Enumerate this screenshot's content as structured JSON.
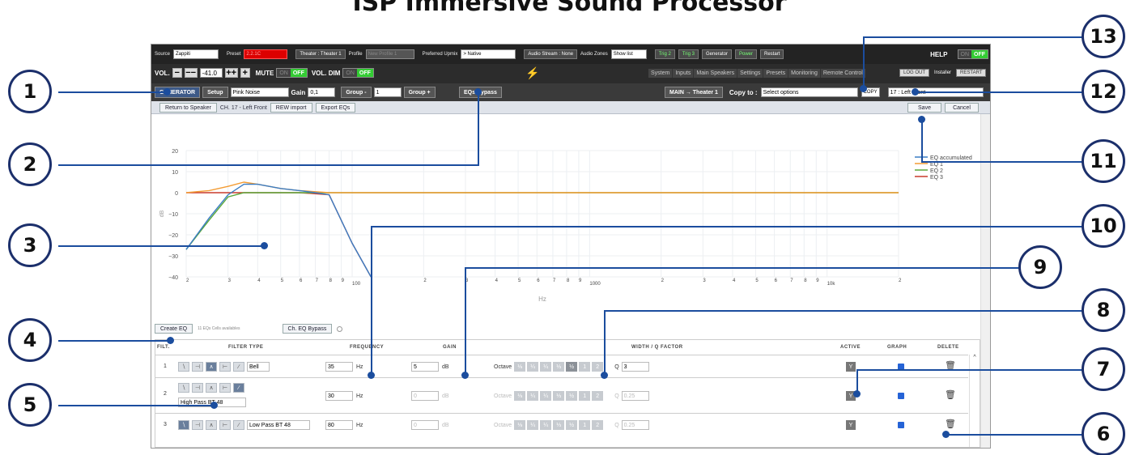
{
  "title": "ISP Immersive Sound Processor",
  "top_bar": {
    "source_label": "Source",
    "source_value": "Zappiti",
    "preset_label": "Preset",
    "preset_value": "2.2.1C",
    "theater_label": "Theater : Theater 1",
    "profile_label": "Profile",
    "profile_value": "New Profile 1",
    "upmix_label": "Preferred Upmix",
    "upmix_value": "> Native",
    "audio_stream": "Audio Stream : None",
    "audio_zones_label": "Audio Zones",
    "audio_zones_value": "Show list",
    "trig2": "Trig 2",
    "trig3": "Trig 3",
    "generator": "Generator",
    "power": "Power",
    "restart": "Restart",
    "help": "HELP",
    "on": "ON",
    "off": "OFF"
  },
  "vol_bar": {
    "vol_label": "VOL.",
    "minus": "−",
    "minus2": "−−",
    "value": "-41.0",
    "plus2": "++",
    "plus": "+",
    "mute_label": "MUTE",
    "mute_on": "ON",
    "mute_off": "OFF",
    "dim_label": "VOL. DIM",
    "dim_on": "ON",
    "dim_off": "OFF",
    "menu": [
      "System",
      "Inputs",
      "Main Speakers",
      "Settings",
      "Presets",
      "Monitoring",
      "Remote Control"
    ],
    "logout": "LOG OUT",
    "installer": "Installer",
    "restart": "RESTART"
  },
  "eq_bar": {
    "generator": "GENERATOR",
    "setup": "Setup",
    "noise": "Pink Noise",
    "gain_label": "Gain",
    "gain_value": "0,1",
    "group_minus": "Group -",
    "group_value": "1",
    "group_plus": "Group +",
    "eqs_bypass": "EQs Bypass",
    "route": "MAIN → Theater 1",
    "copy_to": "Copy to :",
    "copy_placeholder": "Select options",
    "copy_btn": "COPY",
    "channel": "17 : Left Front"
  },
  "sub_bar": {
    "return": "Return to Speaker",
    "channel_label": "CH. 17 - Left Front",
    "rew": "REW import",
    "export": "Export EQs",
    "save": "Save",
    "cancel": "Cancel"
  },
  "chart_data": {
    "type": "line",
    "x_scale": "log",
    "xlim": [
      20,
      20000
    ],
    "ylim": [
      -40,
      20
    ],
    "yticks": [
      "20",
      "10",
      "0",
      "−10",
      "−20",
      "−30",
      "−40"
    ],
    "xticks": [
      "2",
      "3",
      "4",
      "5",
      "6",
      "7",
      "8",
      "9",
      "100",
      "2",
      "3",
      "4",
      "5",
      "6",
      "7",
      "8",
      "9",
      "1000",
      "2",
      "3",
      "4",
      "5",
      "6",
      "7",
      "8",
      "9",
      "10k",
      "2"
    ],
    "xlabel": "Hz",
    "ylabel": "dB",
    "grid": true,
    "legend_position": "top-right",
    "series": [
      {
        "name": "EQ accumulated",
        "color": "#3b7dc4",
        "x": [
          20,
          25,
          30,
          35,
          40,
          50,
          60,
          70,
          80,
          100,
          120
        ],
        "y": [
          -27,
          -12,
          -1,
          4,
          4,
          2,
          1,
          0,
          -1,
          -24,
          -40
        ]
      },
      {
        "name": "EQ 1",
        "color": "#f39c34",
        "x": [
          20,
          25,
          30,
          35,
          40,
          50,
          60,
          80,
          20000
        ],
        "y": [
          0,
          1,
          3,
          5,
          4,
          2,
          1,
          0,
          0
        ]
      },
      {
        "name": "EQ 2",
        "color": "#5aa83b",
        "x": [
          20,
          25,
          30,
          35,
          40,
          50,
          100,
          20000
        ],
        "y": [
          -27,
          -13,
          -2,
          0,
          0,
          0,
          0,
          0
        ]
      },
      {
        "name": "EQ 3",
        "color": "#c93a2b",
        "x": [
          20,
          60,
          70,
          80,
          100,
          120
        ],
        "y": [
          0,
          0,
          -0.5,
          -1,
          -24,
          -40
        ]
      }
    ]
  },
  "eq_controls": {
    "create": "Create EQ",
    "cells": "11 EQs Cells availables",
    "ch_bypass": "Ch. EQ Bypass"
  },
  "table": {
    "headers": [
      "FILT.",
      "FILTER TYPE",
      "FREQUENCY",
      "GAIN",
      "WIDTH / Q FACTOR",
      "ACTIVE",
      "GRAPH",
      "DELETE"
    ],
    "octave_label": "Octave",
    "octave_opts": [
      "⅛",
      "¼",
      "¼",
      "⅓",
      "½",
      "1",
      "2"
    ],
    "hz": "Hz",
    "db": "dB",
    "q": "Q",
    "active_btn": "Y",
    "rows": [
      {
        "num": "1",
        "type": "Bell",
        "freq": "35",
        "gain": "5",
        "q": "3"
      },
      {
        "num": "2",
        "type": "High Pass BT 48",
        "freq": "30",
        "gain": "0",
        "q": "0.25"
      },
      {
        "num": "3",
        "type": "Low Pass BT 48",
        "freq": "80",
        "gain": "0",
        "q": "0.25"
      }
    ]
  },
  "callouts": [
    "1",
    "2",
    "3",
    "4",
    "5",
    "6",
    "7",
    "8",
    "9",
    "10",
    "11",
    "12",
    "13"
  ]
}
